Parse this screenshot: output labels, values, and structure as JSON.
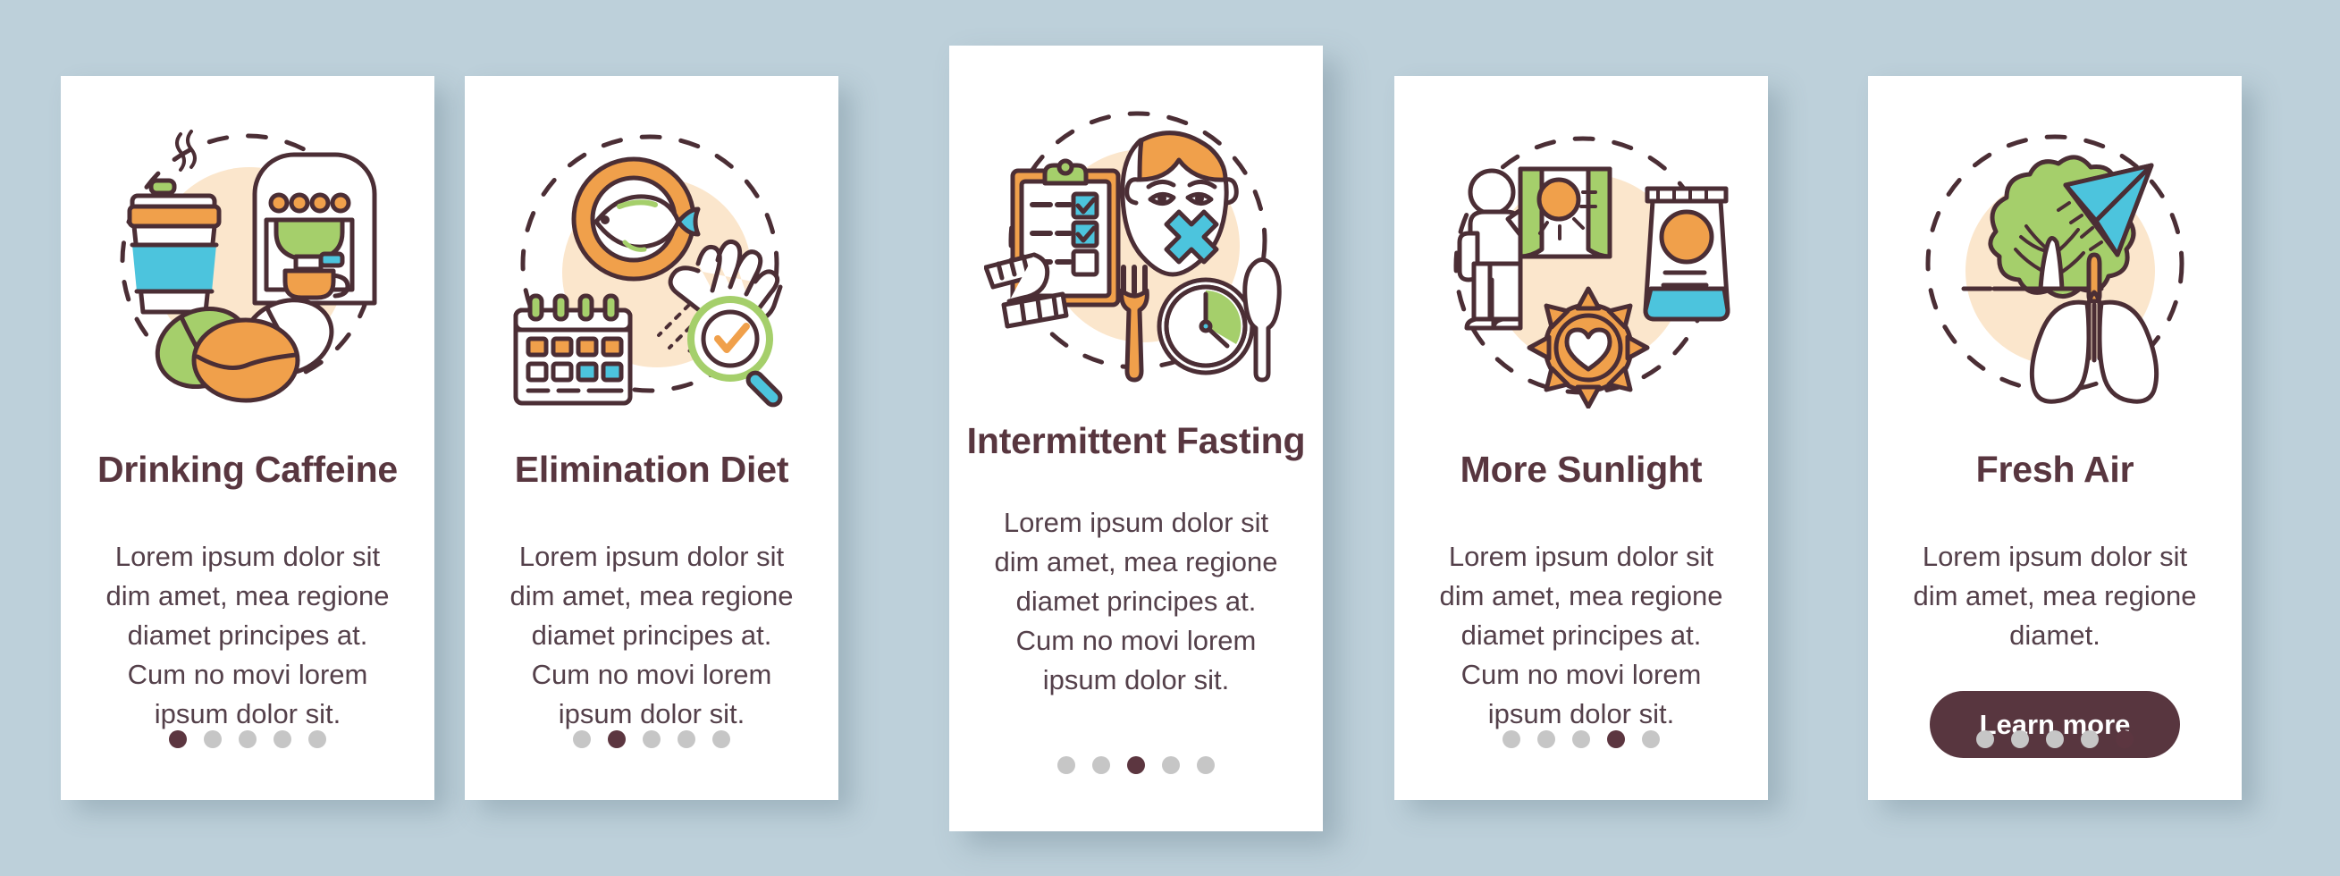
{
  "page": {
    "background_color": "#bdd0da",
    "card_background": "#ffffff",
    "title_color": "#58363f",
    "body_color": "#54404a",
    "dot_active_color": "#5c3640",
    "dot_inactive_color": "#c6c6c6",
    "accent_orange": "#f0a04b",
    "accent_green": "#a5cf6b",
    "accent_blue": "#4cc4dd",
    "accent_cream": "#fbe6cc",
    "outline_color": "#4b2e35"
  },
  "cards": [
    {
      "id": "drinking-caffeine",
      "title": "Drinking Caffeine",
      "body": "Lorem ipsum dolor sit dim amet, mea regione diamet principes at. Cum no movi lorem ipsum dolor sit.",
      "illustration": "coffee-cup-espresso-machine-beans-icon",
      "dots": {
        "count": 5,
        "active_index": 0
      },
      "has_button": false
    },
    {
      "id": "elimination-diet",
      "title": "Elimination Diet",
      "body": "Lorem ipsum dolor sit dim amet, mea regione diamet principes at. Cum no movi lorem ipsum dolor sit.",
      "illustration": "fish-plate-calendar-hand-magnifier-icon",
      "dots": {
        "count": 5,
        "active_index": 1
      },
      "has_button": false
    },
    {
      "id": "intermittent-fasting",
      "title": "Intermittent Fasting",
      "body": "Lorem ipsum dolor sit dim amet, mea regione diamet principes at. Cum no movi lorem ipsum dolor sit.",
      "illustration": "clipboard-face-fork-clock-knife-icon",
      "dots": {
        "count": 5,
        "active_index": 2
      },
      "has_button": false
    },
    {
      "id": "more-sunlight",
      "title": "More Sunlight",
      "body": "Lorem ipsum dolor sit dim amet, mea regione diamet principes at. Cum no movi lorem ipsum dolor sit.",
      "illustration": "person-window-sun-sunscreen-icon",
      "dots": {
        "count": 5,
        "active_index": 3
      },
      "has_button": false
    },
    {
      "id": "fresh-air",
      "title": "Fresh Air",
      "body": "Lorem ipsum dolor sit dim amet, mea regione diamet.",
      "illustration": "tree-paper-plane-lungs-icon",
      "dots": {
        "count": 5,
        "active_index": 4
      },
      "has_button": true,
      "button_label": "Learn more"
    }
  ]
}
